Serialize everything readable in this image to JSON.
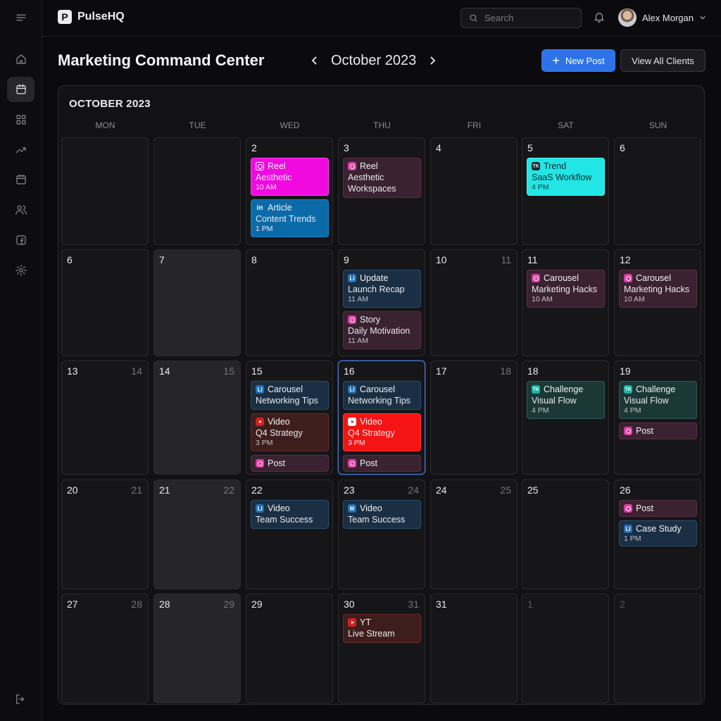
{
  "app": {
    "name": "PulseHQ",
    "logo_letter": "P"
  },
  "topbar": {
    "search_placeholder": "Search",
    "user_name": "Alex Morgan"
  },
  "header": {
    "title": "Marketing Command Center",
    "month": "October 2023",
    "new_post": "New Post",
    "view_clients": "View All Clients"
  },
  "sidebar": {
    "items": [
      {
        "name": "menu",
        "icon": "menu-icon"
      },
      {
        "name": "home",
        "icon": "home-icon"
      },
      {
        "name": "calendar",
        "icon": "calendar-icon",
        "active": true
      },
      {
        "name": "dashboard",
        "icon": "grid-icon"
      },
      {
        "name": "analytics",
        "icon": "trending-icon"
      },
      {
        "name": "schedule",
        "icon": "calendar-icon"
      },
      {
        "name": "team",
        "icon": "users-icon"
      },
      {
        "name": "facebook",
        "icon": "facebook-icon"
      },
      {
        "name": "settings",
        "icon": "gear-icon"
      }
    ],
    "logout_icon": "logout-icon"
  },
  "colors": {
    "accent": "#2e72e8",
    "today_border": "#4a78d8",
    "instagram": "#f00ae0",
    "linkedin": "#0b6aa8",
    "youtube": "#f41414",
    "tiktok": "#22e6e6"
  },
  "calendar": {
    "title": "OCTOBER 2023",
    "weekdays": [
      "MON",
      "TUE",
      "WED",
      "THU",
      "FRI",
      "SAT",
      "SUN"
    ],
    "weeks": [
      [
        {
          "n": "",
          "alt": ""
        },
        {
          "n": "",
          "alt": ""
        },
        {
          "n": "2",
          "alt": "",
          "events": [
            {
              "platform": "ig",
              "style": "c-ig-hot",
              "icon_style": "white",
              "kind": "Reel",
              "title": "Aesthetic",
              "time": "10 AM"
            },
            {
              "platform": "li",
              "style": "c-li-hot",
              "icon_style": "plain",
              "icon_text": "in",
              "kind": "Article",
              "title": "Content Trends",
              "time": "1 PM"
            }
          ]
        },
        {
          "n": "3",
          "alt": "",
          "events": [
            {
              "platform": "ig",
              "style": "c-ig",
              "kind": "Reel",
              "title": "Aesthetic Workspaces",
              "title2": true
            }
          ]
        },
        {
          "n": "4",
          "alt": ""
        },
        {
          "n": "5",
          "alt": "",
          "events": [
            {
              "platform": "tk",
              "style": "c-tk-hot",
              "icon_text": "TK",
              "kind": "Trend",
              "title": "SaaS Workflow",
              "time": "4 PM"
            }
          ]
        },
        {
          "n": "6",
          "alt": ""
        }
      ],
      [
        {
          "n": "6",
          "alt": ""
        },
        {
          "n": "7",
          "alt": "",
          "shade": true
        },
        {
          "n": "8",
          "alt": ""
        },
        {
          "n": "9",
          "alt": "",
          "events": [
            {
              "platform": "li",
              "style": "c-li",
              "icon_text": "LI",
              "kind": "Update",
              "title": "Launch Recap",
              "time": "11 AM"
            },
            {
              "platform": "ig",
              "style": "c-ig",
              "kind": "Story",
              "title": "Daily Motivation",
              "time": "11 AM"
            }
          ]
        },
        {
          "n": "10",
          "alt": "11"
        },
        {
          "n": "11",
          "alt": "",
          "events": [
            {
              "platform": "ig",
              "style": "c-ig",
              "kind": "Carousel",
              "title": "Marketing Hacks",
              "time": "10 AM"
            }
          ]
        },
        {
          "n": "12",
          "alt": "",
          "events": [
            {
              "platform": "ig",
              "style": "c-ig",
              "kind": "Carousel",
              "title": "Marketing Hacks",
              "time": "10 AM"
            }
          ]
        }
      ],
      [
        {
          "n": "13",
          "alt": "14"
        },
        {
          "n": "14",
          "alt": "15",
          "shade": true
        },
        {
          "n": "15",
          "alt": "",
          "events": [
            {
              "platform": "li",
              "style": "c-li",
              "icon_text": "LI",
              "kind": "Carousel",
              "title": "Networking Tips"
            },
            {
              "platform": "yt",
              "style": "c-yt",
              "kind": "Video",
              "title": "Q4 Strategy",
              "time": "3 PM"
            },
            {
              "platform": "ig",
              "style": "c-ig",
              "kind": "Post"
            }
          ]
        },
        {
          "n": "16",
          "alt": "",
          "today": true,
          "events": [
            {
              "platform": "li",
              "style": "c-li",
              "icon_text": "LI",
              "kind": "Carousel",
              "title": "Networking Tips"
            },
            {
              "platform": "yt",
              "style": "c-yt-hot",
              "icon_style": "white",
              "kind": "Video",
              "title": "Q4 Strategy",
              "time": "3 PM"
            },
            {
              "platform": "ig",
              "style": "c-ig",
              "kind": "Post"
            }
          ]
        },
        {
          "n": "17",
          "alt": "18"
        },
        {
          "n": "18",
          "alt": "",
          "events": [
            {
              "platform": "tk",
              "style": "c-tk",
              "icon_style": "teal",
              "icon_text": "TK",
              "kind": "Challenge",
              "title": "Visual Flow",
              "time": "4 PM"
            }
          ]
        },
        {
          "n": "19",
          "alt": "",
          "events": [
            {
              "platform": "tk",
              "style": "c-tk",
              "icon_style": "teal",
              "icon_text": "TK",
              "kind": "Challenge",
              "title": "Visual Flow",
              "time": "4 PM"
            },
            {
              "platform": "ig",
              "style": "c-ig",
              "kind": "Post"
            }
          ]
        }
      ],
      [
        {
          "n": "20",
          "alt": "21"
        },
        {
          "n": "21",
          "alt": "22",
          "shade": true
        },
        {
          "n": "22",
          "alt": "",
          "events": [
            {
              "platform": "li",
              "style": "c-li",
              "icon_text": "LI",
              "kind": "Video",
              "title": "Team Success"
            }
          ]
        },
        {
          "n": "23",
          "alt": "24",
          "events": [
            {
              "platform": "li",
              "style": "c-li",
              "icon_text": "M",
              "kind": "Video",
              "title": "Team Success"
            }
          ]
        },
        {
          "n": "24",
          "alt": "25"
        },
        {
          "n": "25",
          "alt": ""
        },
        {
          "n": "26",
          "alt": "",
          "events": [
            {
              "platform": "ig",
              "style": "c-ig",
              "kind": "Post"
            },
            {
              "platform": "li",
              "style": "c-li",
              "icon_text": "LI",
              "kind": "Case Study",
              "time": "1 PM"
            }
          ]
        }
      ],
      [
        {
          "n": "27",
          "alt": "28"
        },
        {
          "n": "28",
          "alt": "29",
          "shade": true
        },
        {
          "n": "29",
          "alt": ""
        },
        {
          "n": "30",
          "alt": "31",
          "events": [
            {
              "platform": "yt",
              "style": "c-yt",
              "kind": "YT",
              "title": "Live Stream"
            }
          ]
        },
        {
          "n": "31",
          "alt": ""
        },
        {
          "n": "1",
          "alt": "",
          "dim": true
        },
        {
          "n": "2",
          "alt": "",
          "dim": true
        }
      ]
    ]
  }
}
